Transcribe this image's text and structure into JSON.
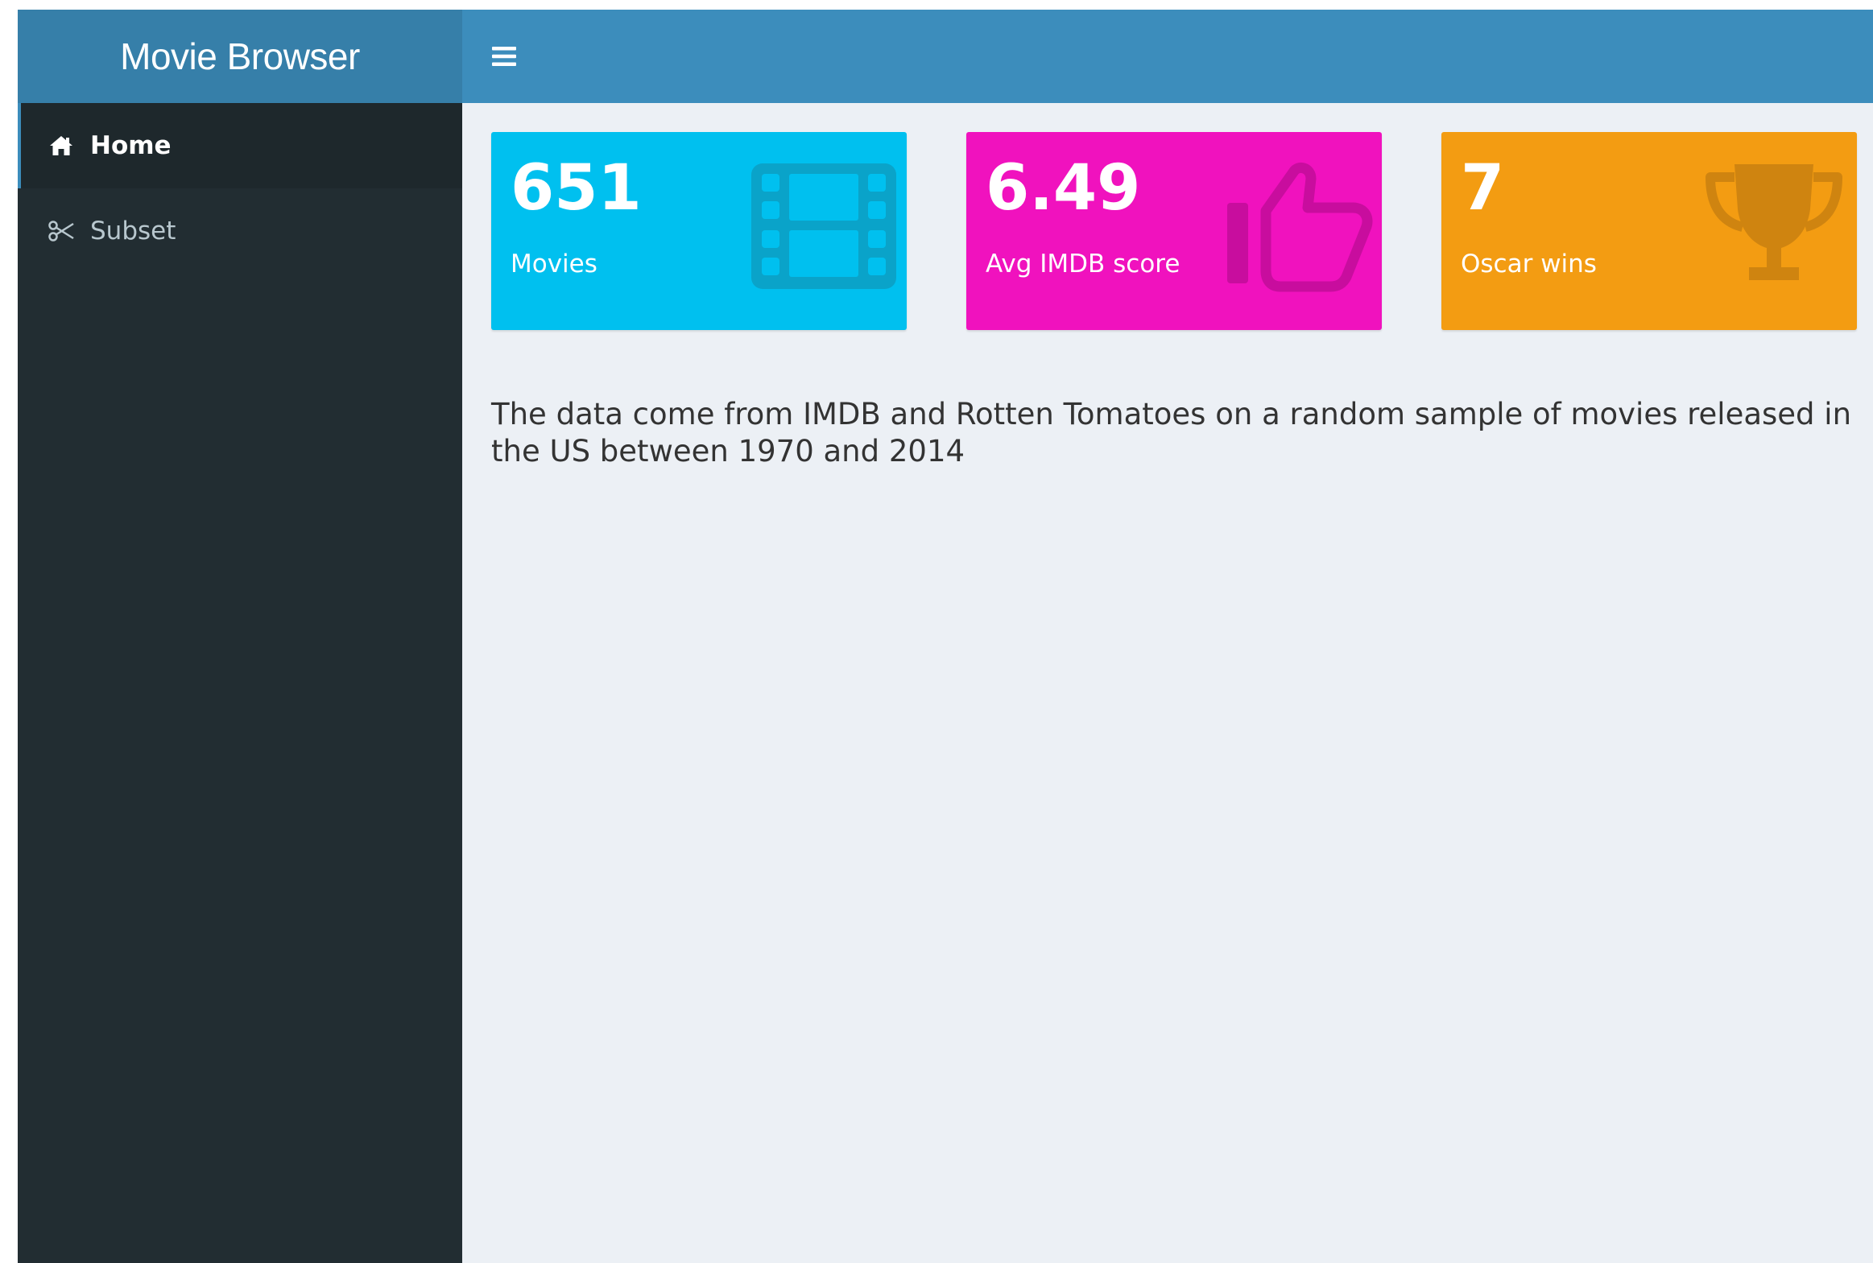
{
  "header": {
    "title": "Movie Browser",
    "menu_toggle_icon": "hamburger-icon"
  },
  "sidebar": {
    "items": [
      {
        "label": "Home",
        "icon": "home-icon",
        "active": true
      },
      {
        "label": "Subset",
        "icon": "scissors-icon",
        "active": false
      }
    ]
  },
  "main": {
    "value_boxes": [
      {
        "value": "651",
        "caption": "Movies",
        "icon": "film-icon",
        "color": "#00c0ef"
      },
      {
        "value": "6.49",
        "caption": "Avg IMDB score",
        "icon": "thumbs-up-icon",
        "color": "#f012be"
      },
      {
        "value": "7",
        "caption": "Oscar wins",
        "icon": "trophy-icon",
        "color": "#f39c12"
      }
    ],
    "description": "The data come from IMDB and Rotten Tomatoes on a random sample of movies released in the US between 1970 and 2014"
  },
  "colors": {
    "header": "#3c8dbc",
    "logo": "#367fa9",
    "sidebar": "#222d32",
    "content_background": "#ecf0f5"
  }
}
